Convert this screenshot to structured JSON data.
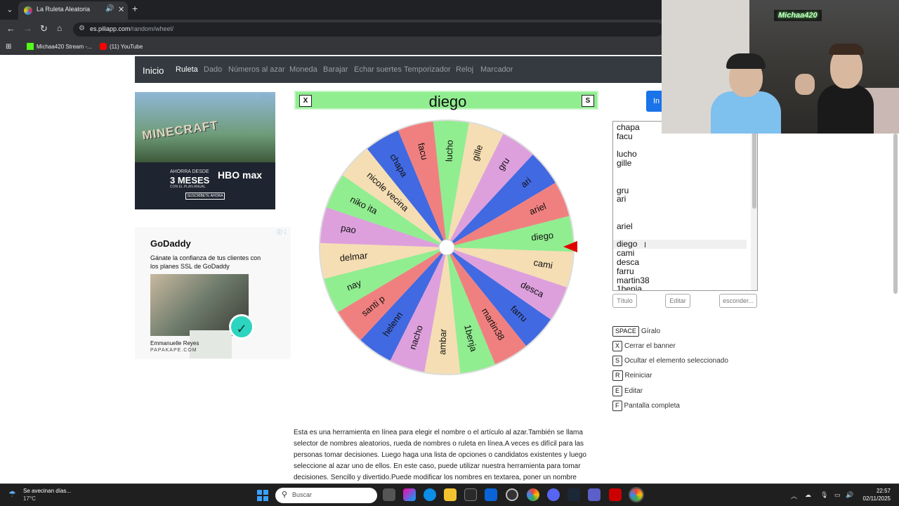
{
  "browser": {
    "tab_title": "La Ruleta Aleatoria",
    "url_host": "es.piliapp.com",
    "url_path": "/random/wheel/",
    "bookmarks": [
      "Michaa420 Stream -...",
      "(11) YouTube"
    ]
  },
  "site_nav": {
    "brand": "Inicio",
    "items": [
      "Ruleta",
      "Dado",
      "Números al azar",
      "Moneda",
      "Barajar",
      "Echar suertes",
      "Temporizador",
      "Reloj",
      "Marcador"
    ],
    "active": "Ruleta"
  },
  "ad_minecraft": {
    "title": "MINECRAFT",
    "line1": "AHORRA DESDE",
    "line2": "3 MESES",
    "line3": "CON EL PLAN ANUAL",
    "brand": "HBO max",
    "cta": "SUSCRÍBETE AHORA"
  },
  "ad_godaddy": {
    "logo": "GoDaddy",
    "text": "Gánate la confianza de tus clientes con los planes SSL de GoDaddy",
    "person": "Emmanuelle Reyes",
    "company": "PAPAKAPE.COM"
  },
  "banner": {
    "close_key": "X",
    "hide_key": "S",
    "selected": "diego"
  },
  "wheel": {
    "segments": [
      {
        "label": "lucho",
        "color": "#90EE90"
      },
      {
        "label": "gille",
        "color": "#F5DEB3"
      },
      {
        "label": "gru",
        "color": "#DDA0DD"
      },
      {
        "label": "ari",
        "color": "#4169E1"
      },
      {
        "label": "ariel",
        "color": "#F08080"
      },
      {
        "label": "diego",
        "color": "#90EE90"
      },
      {
        "label": "cami",
        "color": "#F5DEB3"
      },
      {
        "label": "desca",
        "color": "#DDA0DD"
      },
      {
        "label": "farru",
        "color": "#4169E1"
      },
      {
        "label": "martin38",
        "color": "#F08080"
      },
      {
        "label": "1benja",
        "color": "#90EE90"
      },
      {
        "label": "ambar",
        "color": "#F5DEB3"
      },
      {
        "label": "nacho",
        "color": "#DDA0DD"
      },
      {
        "label": "helenn",
        "color": "#4169E1"
      },
      {
        "label": "santi p",
        "color": "#F08080"
      },
      {
        "label": "nay",
        "color": "#90EE90"
      },
      {
        "label": "delmar",
        "color": "#F5DEB3"
      },
      {
        "label": "pao",
        "color": "#DDA0DD"
      },
      {
        "label": "niko ita",
        "color": "#90EE90"
      },
      {
        "label": "nicole vecina",
        "color": "#F5DEB3"
      },
      {
        "label": "chapa",
        "color": "#4169E1"
      },
      {
        "label": "facu",
        "color": "#F08080"
      }
    ],
    "pointer_color": "#E00000"
  },
  "names_textarea": {
    "lines": [
      "chapa",
      "facu",
      "",
      "lucho",
      "gille",
      "",
      "",
      "gru",
      "ari",
      "",
      "",
      "ariel",
      "",
      "diego",
      "cami",
      "desca",
      "farru",
      "martin38",
      "1benja"
    ]
  },
  "controls": {
    "title_btn": "Título",
    "edit_btn": "Editar",
    "hide_btn": "esconder...",
    "start_btn_partial": "In"
  },
  "shortcuts": [
    {
      "key": "SPACE",
      "label": "Gíralo"
    },
    {
      "key": "X",
      "label": "Cerrar el banner"
    },
    {
      "key": "S",
      "label": "Ocultar el elemento seleccionado"
    },
    {
      "key": "R",
      "label": "Reiniciar"
    },
    {
      "key": "E",
      "label": "Editar"
    },
    {
      "key": "F",
      "label": "Pantalla completa"
    }
  ],
  "description": "Esta es una herramienta en línea para elegir el nombre o el artículo al azar.También se llama selector de nombres aleatorios, rueda de nombres o ruleta en línea.A veces es difícil para las personas tomar decisiones. Luego haga una lista de opciones o candidatos existentes y luego seleccione al azar uno de ellos. En este caso, puede utilizar nuestra herramienta para tomar decisiones. Sencillo y divertido.Puede modificar los nombres en textarea, poner un nombre",
  "webcam": {
    "sign": "Michaa420"
  },
  "taskbar": {
    "weather_title": "Se avecinan días...",
    "weather_temp": "17°C",
    "search_placeholder": "Buscar",
    "time": "22:57",
    "date": "02/11/2025"
  }
}
